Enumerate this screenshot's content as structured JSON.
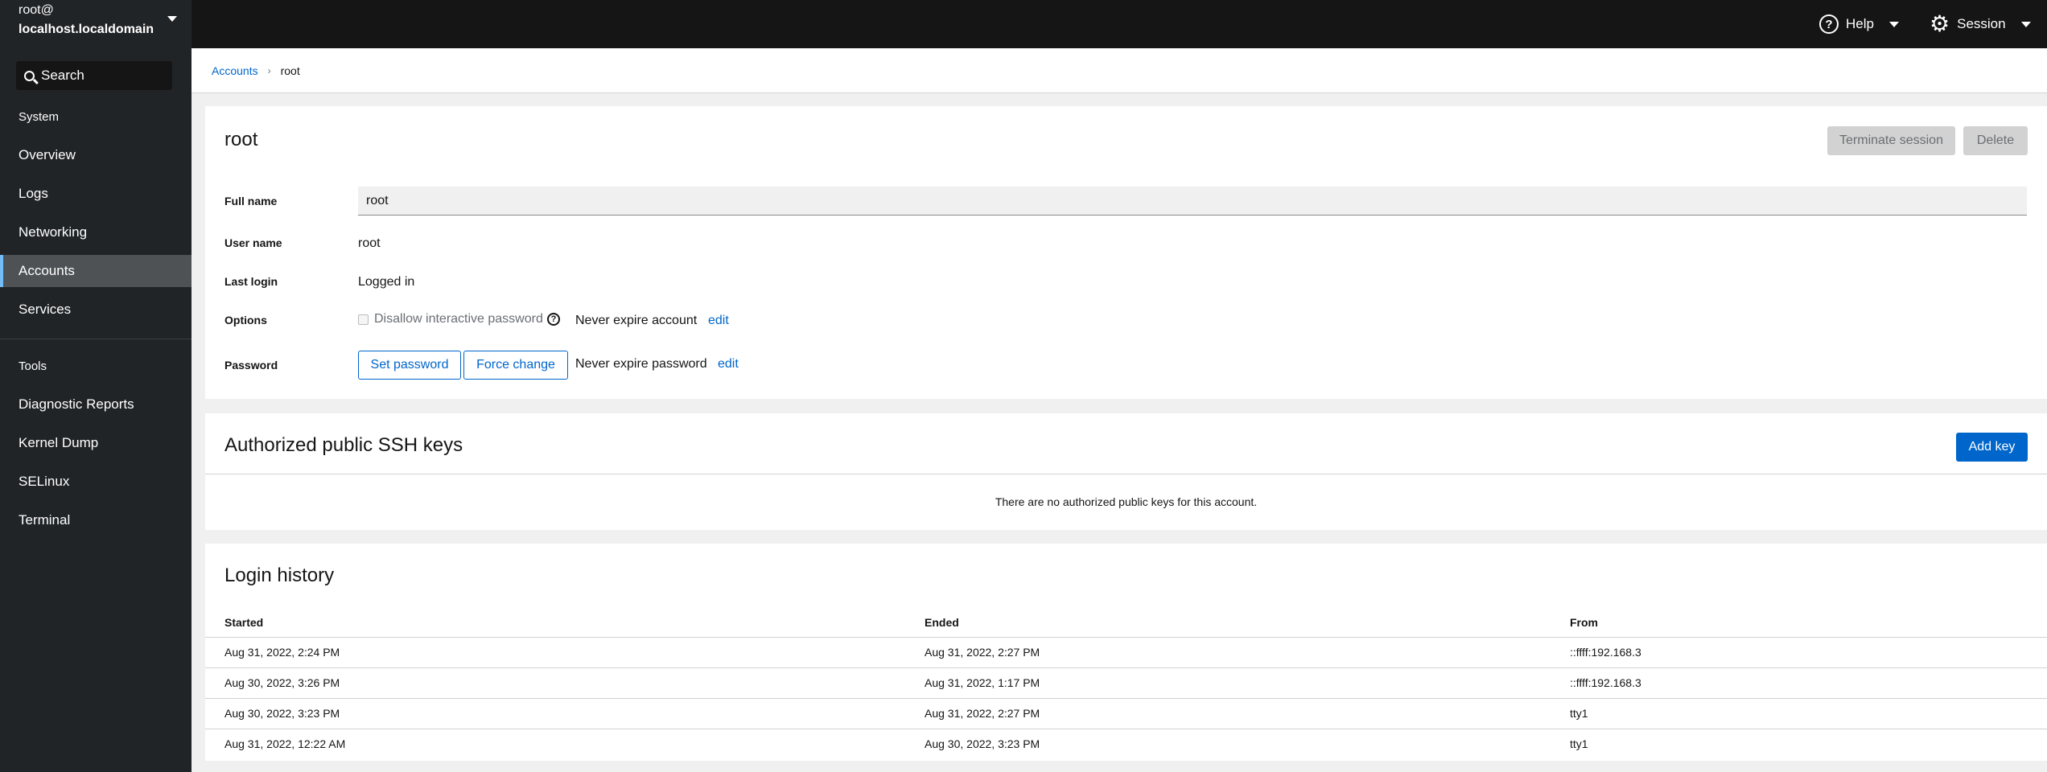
{
  "header": {
    "user": "root@",
    "host": "localhost.localdomain",
    "help_label": "Help",
    "session_label": "Session"
  },
  "sidebar": {
    "search_label": "Search",
    "system_label": "System",
    "tools_label": "Tools",
    "system_items": [
      {
        "label": "Overview"
      },
      {
        "label": "Logs"
      },
      {
        "label": "Networking"
      },
      {
        "label": "Accounts"
      },
      {
        "label": "Services"
      }
    ],
    "tools_items": [
      {
        "label": "Diagnostic Reports"
      },
      {
        "label": "Kernel Dump"
      },
      {
        "label": "SELinux"
      },
      {
        "label": "Terminal"
      }
    ],
    "active_item": "Accounts"
  },
  "breadcrumb": {
    "parent": "Accounts",
    "current": "root"
  },
  "account": {
    "title": "root",
    "terminate_label": "Terminate session",
    "delete_label": "Delete",
    "full_name_label": "Full name",
    "full_name_value": "root",
    "user_name_label": "User name",
    "user_name_value": "root",
    "last_login_label": "Last login",
    "last_login_value": "Logged in",
    "options_label": "Options",
    "disallow_label": "Disallow interactive password",
    "disallow_checked": false,
    "never_expire_account": "Never expire account",
    "edit_label": "edit",
    "password_label": "Password",
    "set_password_label": "Set password",
    "force_change_label": "Force change",
    "never_expire_password": "Never expire password"
  },
  "ssh_keys": {
    "title": "Authorized public SSH keys",
    "add_key_label": "Add key",
    "empty_message": "There are no authorized public keys for this account."
  },
  "login_history": {
    "title": "Login history",
    "columns": [
      "Started",
      "Ended",
      "From"
    ],
    "rows": [
      [
        "Aug 31, 2022, 2:24 PM",
        "Aug 31, 2022, 2:27 PM",
        "::ffff:192.168.3"
      ],
      [
        "Aug 30, 2022, 3:26 PM",
        "Aug 31, 2022, 1:17 PM",
        "::ffff:192.168.3"
      ],
      [
        "Aug 30, 2022, 3:23 PM",
        "Aug 31, 2022, 2:27 PM",
        "tty1"
      ],
      [
        "Aug 31, 2022, 12:22 AM",
        "Aug 30, 2022, 3:23 PM",
        "tty1"
      ]
    ]
  },
  "colors": {
    "accent": "#0066cc",
    "topbar": "#151515",
    "sidebar": "#212427",
    "active_nav": "#4f5255",
    "active_indicator": "#73bcf7"
  }
}
